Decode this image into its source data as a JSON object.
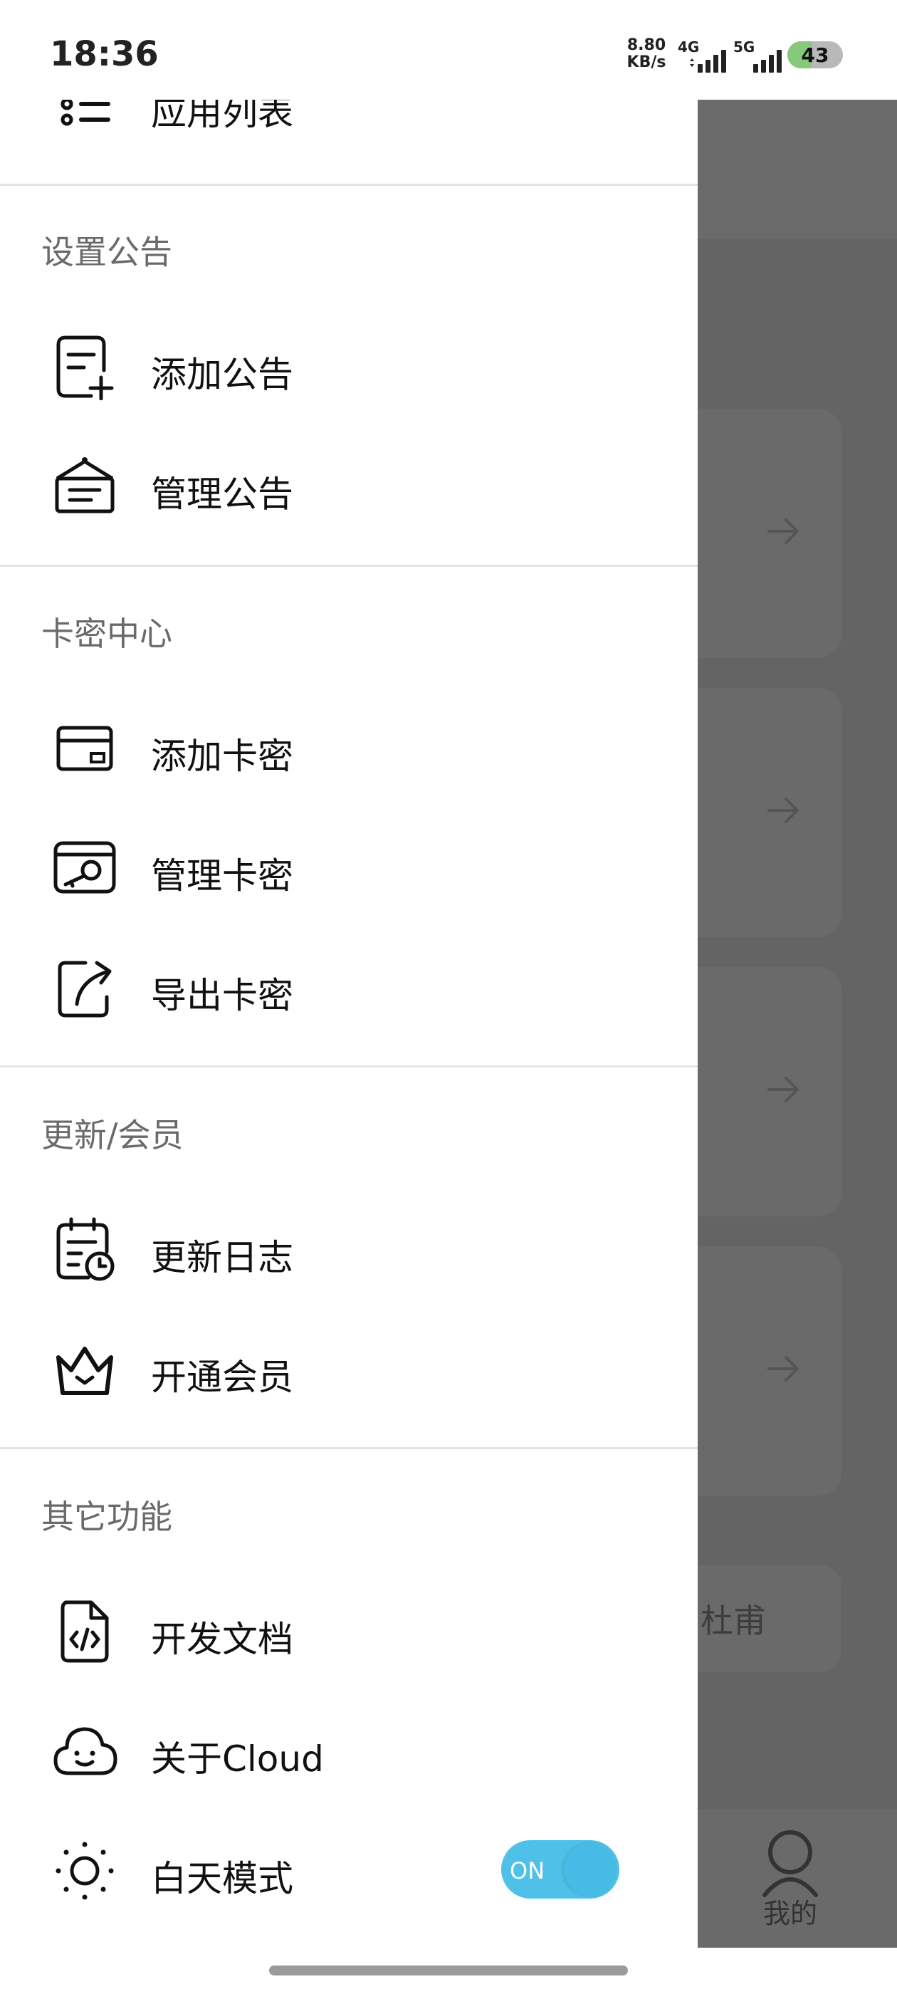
{
  "status_bar": {
    "time": "18:36",
    "net_speed_value": "8.80",
    "net_speed_unit": "KB/s",
    "signal_1_label": "4G",
    "signal_2_label": "5G",
    "battery_level": "43",
    "battery_color": "#86c97a"
  },
  "drawer": {
    "top_item_label": "应用列表",
    "sections": [
      {
        "title": "设置公告",
        "items": [
          {
            "label": "添加公告",
            "icon": "add-note-icon"
          },
          {
            "label": "管理公告",
            "icon": "hanging-sign-icon"
          }
        ]
      },
      {
        "title": "卡密中心",
        "items": [
          {
            "label": "添加卡密",
            "icon": "card-icon"
          },
          {
            "label": "管理卡密",
            "icon": "card-key-icon"
          },
          {
            "label": "导出卡密",
            "icon": "export-icon"
          }
        ]
      },
      {
        "title": "更新/会员",
        "items": [
          {
            "label": "更新日志",
            "icon": "calendar-clock-icon"
          },
          {
            "label": "开通会员",
            "icon": "crown-icon"
          }
        ]
      },
      {
        "title": "其它功能",
        "items": [
          {
            "label": "开发文档",
            "icon": "code-file-icon"
          },
          {
            "label": "关于Cloud",
            "icon": "cloud-smile-icon"
          },
          {
            "label": "白天模式",
            "icon": "sun-icon"
          }
        ]
      }
    ],
    "day_mode_toggle": {
      "state_text": "ON",
      "on": true,
      "accent": "#4fc0e8"
    }
  },
  "background_app": {
    "name_text": "杜甫",
    "tab_label": "我的"
  }
}
